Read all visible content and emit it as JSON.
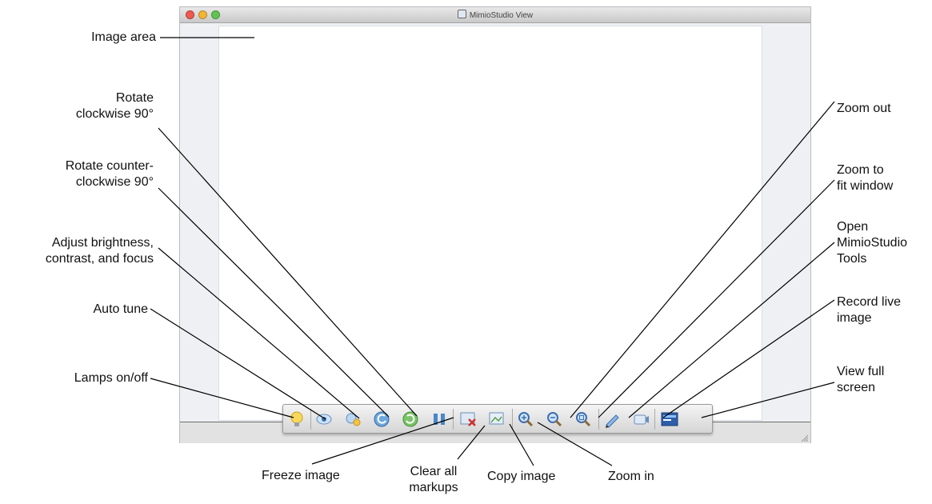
{
  "window": {
    "title": "MimioStudio View",
    "traffic_lights": [
      "#ee5a4f",
      "#f2b537",
      "#61c452"
    ]
  },
  "labels": {
    "image_area": "Image area",
    "rotate_clockwise": [
      "Rotate",
      "clockwise 90°"
    ],
    "rotate_counter": [
      "Rotate counter-",
      "clockwise 90°"
    ],
    "adjust": [
      "Adjust brightness,",
      "contrast, and focus"
    ],
    "auto_tune": "Auto tune",
    "lamps": "Lamps on/off",
    "zoom_out": "Zoom out",
    "zoom_fit": [
      "Zoom to",
      "fit window"
    ],
    "open_tools": [
      "Open",
      "MimioStudio",
      "Tools"
    ],
    "record": [
      "Record live",
      "image"
    ],
    "full_screen": [
      "View full",
      "screen"
    ],
    "freeze": "Freeze image",
    "clear": [
      "Clear all",
      "markups"
    ],
    "copy": "Copy image",
    "zoom_in": "Zoom in"
  },
  "toolbar": {
    "buttons": [
      {
        "id": "lamps",
        "icon": "lamp-icon"
      },
      {
        "id": "auto-tune",
        "icon": "eye-icon"
      },
      {
        "id": "adjust",
        "icon": "brightness-icon"
      },
      {
        "id": "rotate-ccw",
        "icon": "rotate-ccw-icon"
      },
      {
        "id": "rotate-cw",
        "icon": "rotate-cw-icon"
      },
      {
        "id": "freeze",
        "icon": "freeze-icon"
      },
      {
        "id": "clear-markups",
        "icon": "clear-markups-icon"
      },
      {
        "id": "copy-image",
        "icon": "copy-image-icon"
      },
      {
        "id": "zoom-in",
        "icon": "zoom-in-icon"
      },
      {
        "id": "zoom-out",
        "icon": "zoom-out-icon"
      },
      {
        "id": "zoom-fit",
        "icon": "zoom-fit-icon"
      },
      {
        "id": "open-tools",
        "icon": "pen-icon"
      },
      {
        "id": "record",
        "icon": "record-icon"
      },
      {
        "id": "full-screen",
        "icon": "full-screen-icon"
      }
    ]
  }
}
